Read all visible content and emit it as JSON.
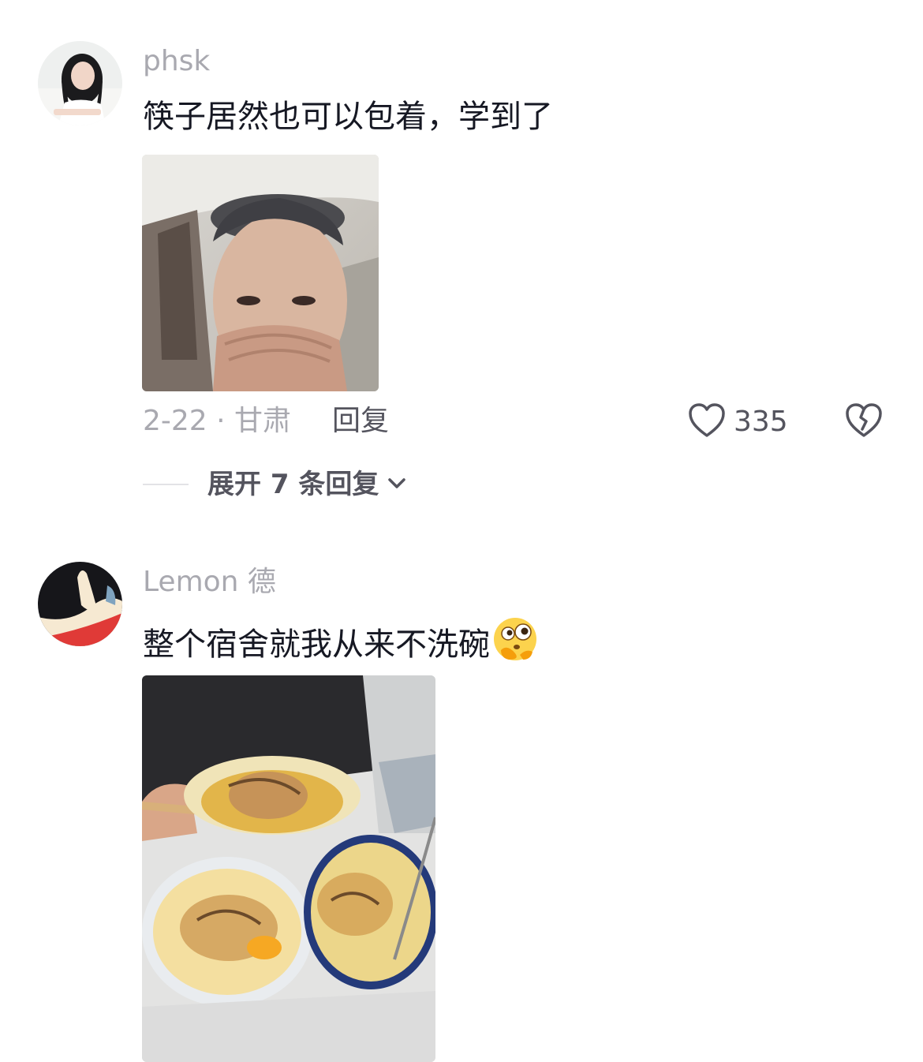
{
  "comments": [
    {
      "username": "phsk",
      "text": "筷子居然也可以包着，学到了",
      "date_location": "2-22 · 甘肃",
      "reply_label": "回复",
      "likes": "335",
      "expand_label": "展开 7 条回复"
    },
    {
      "username": "Lemon 德",
      "text": "整个宿舍就我从来不洗碗",
      "emoji": "thinking-face-emoji"
    }
  ],
  "icons": {
    "like": "heart-outline-icon",
    "dislike": "broken-heart-icon",
    "expand": "chevron-down-icon"
  },
  "colors": {
    "username": "#a9a9b0",
    "text": "#161823",
    "secondary": "#54545e"
  }
}
